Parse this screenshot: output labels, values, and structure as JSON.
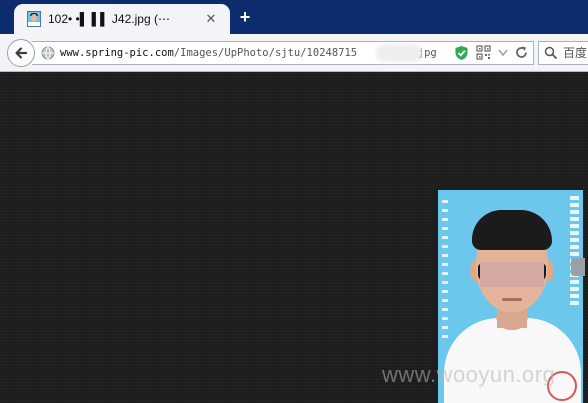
{
  "window": {
    "tab_title": "102• •▌  ▌▌ J42.jpg (⋯",
    "tab_close_glyph": "✕",
    "new_tab_glyph": "+"
  },
  "navbar": {
    "url_host": "www.spring-pic.com",
    "url_path": "/Images/UpPhoto/sjtu/10248715",
    "url_tail": "2.jpg",
    "search_placeholder": "百度"
  },
  "content": {
    "image_kind": "id-photo",
    "watermark": "www.wooyun.org"
  },
  "colors": {
    "tabstrip": "#0c2c6e",
    "toolbar": "#f2f4f7",
    "viewport": "#1c1c1c",
    "photo_background": "#6cc7ec",
    "shield": "#34a853"
  }
}
